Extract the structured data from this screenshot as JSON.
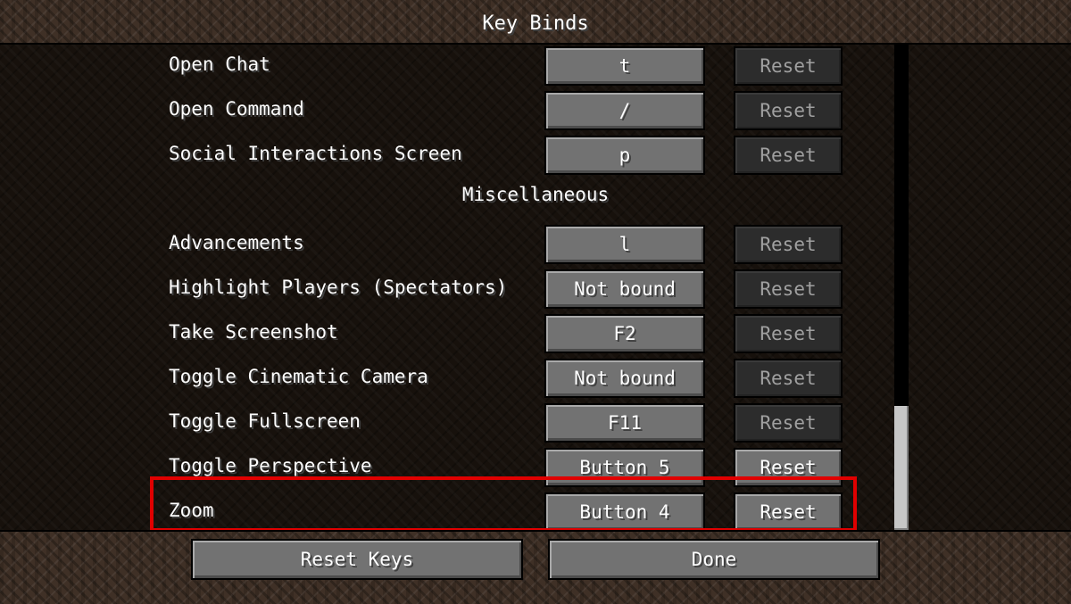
{
  "screen": {
    "title": "Key Binds"
  },
  "rows_top": [
    {
      "label": "Open Chat",
      "key": "t",
      "reset": "Reset",
      "reset_enabled": false
    },
    {
      "label": "Open Command",
      "key": "/",
      "reset": "Reset",
      "reset_enabled": false
    },
    {
      "label": "Social Interactions Screen",
      "key": "p",
      "reset": "Reset",
      "reset_enabled": false
    }
  ],
  "category": "Miscellaneous",
  "rows_misc": [
    {
      "label": "Advancements",
      "key": "l",
      "reset": "Reset",
      "reset_enabled": false
    },
    {
      "label": "Highlight Players (Spectators)",
      "key": "Not bound",
      "reset": "Reset",
      "reset_enabled": false
    },
    {
      "label": "Take Screenshot",
      "key": "F2",
      "reset": "Reset",
      "reset_enabled": false
    },
    {
      "label": "Toggle Cinematic Camera",
      "key": "Not bound",
      "reset": "Reset",
      "reset_enabled": false
    },
    {
      "label": "Toggle Fullscreen",
      "key": "F11",
      "reset": "Reset",
      "reset_enabled": false
    },
    {
      "label": "Toggle Perspective",
      "key": "Button 5",
      "reset": "Reset",
      "reset_enabled": true
    },
    {
      "label": "Zoom",
      "key": "Button 4",
      "reset": "Reset",
      "reset_enabled": true
    }
  ],
  "footer": {
    "reset_keys": "Reset Keys",
    "done": "Done"
  },
  "colors": {
    "highlight": "#e00000",
    "button": "#727272",
    "button_disabled": "#2c2c2c"
  }
}
